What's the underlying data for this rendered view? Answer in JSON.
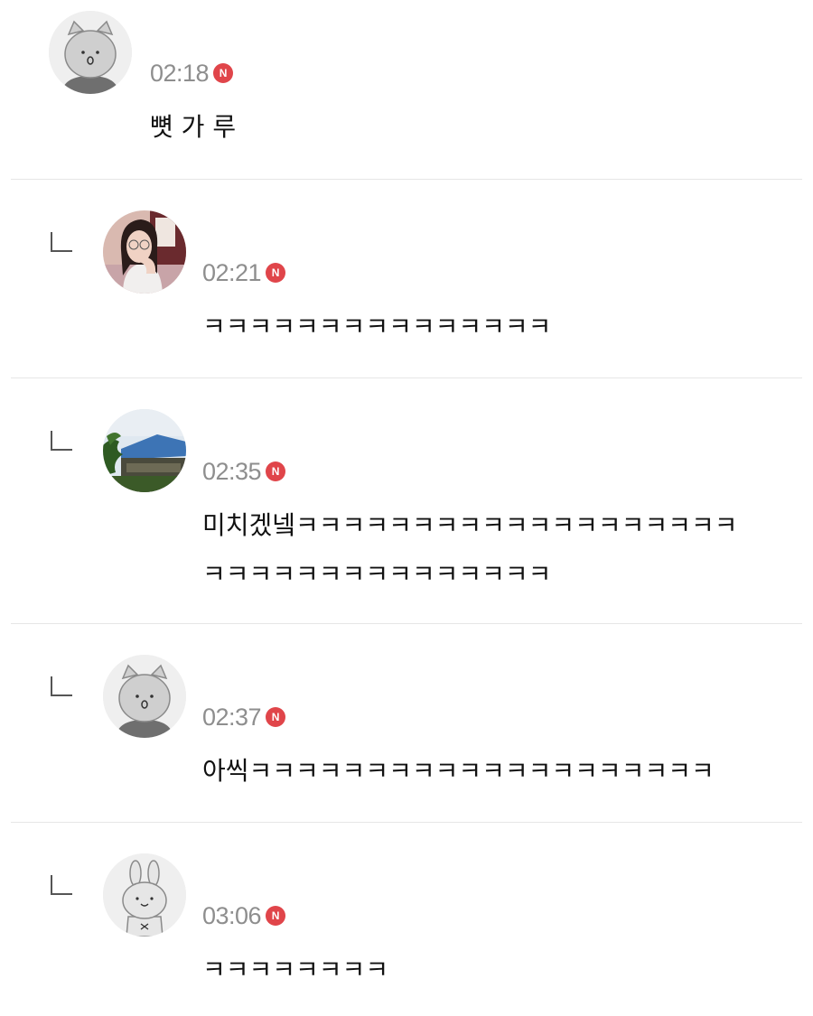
{
  "comments": [
    {
      "time": "02:18",
      "badge": "N",
      "avatar_icon": "cat-default-avatar",
      "text": "뼛 가 루"
    },
    {
      "time": "02:21",
      "badge": "N",
      "avatar_icon": "user-photo-avatar",
      "text": "ㅋㅋㅋㅋㅋㅋㅋㅋㅋㅋㅋㅋㅋㅋㅋ"
    },
    {
      "time": "02:35",
      "badge": "N",
      "avatar_icon": "building-photo-avatar",
      "text": "미치겠넼ㅋㅋㅋㅋㅋㅋㅋㅋㅋㅋㅋㅋㅋㅋㅋㅋㅋㅋㅋㅋㅋㅋㅋㅋㅋㅋㅋㅋㅋㅋㅋㅋㅋㅋ"
    },
    {
      "time": "02:37",
      "badge": "N",
      "avatar_icon": "cat-default-avatar",
      "text": "아씩ㅋㅋㅋㅋㅋㅋㅋㅋㅋㅋㅋㅋㅋㅋㅋㅋㅋㅋㅋㅋ"
    },
    {
      "time": "03:06",
      "badge": "N",
      "avatar_icon": "rabbit-default-avatar",
      "text": "ㅋㅋㅋㅋㅋㅋㅋㅋ"
    }
  ],
  "colors": {
    "time": "#8e8e8e",
    "badge": "#e0454a",
    "divider": "#e6e6e6",
    "text": "#111111"
  }
}
